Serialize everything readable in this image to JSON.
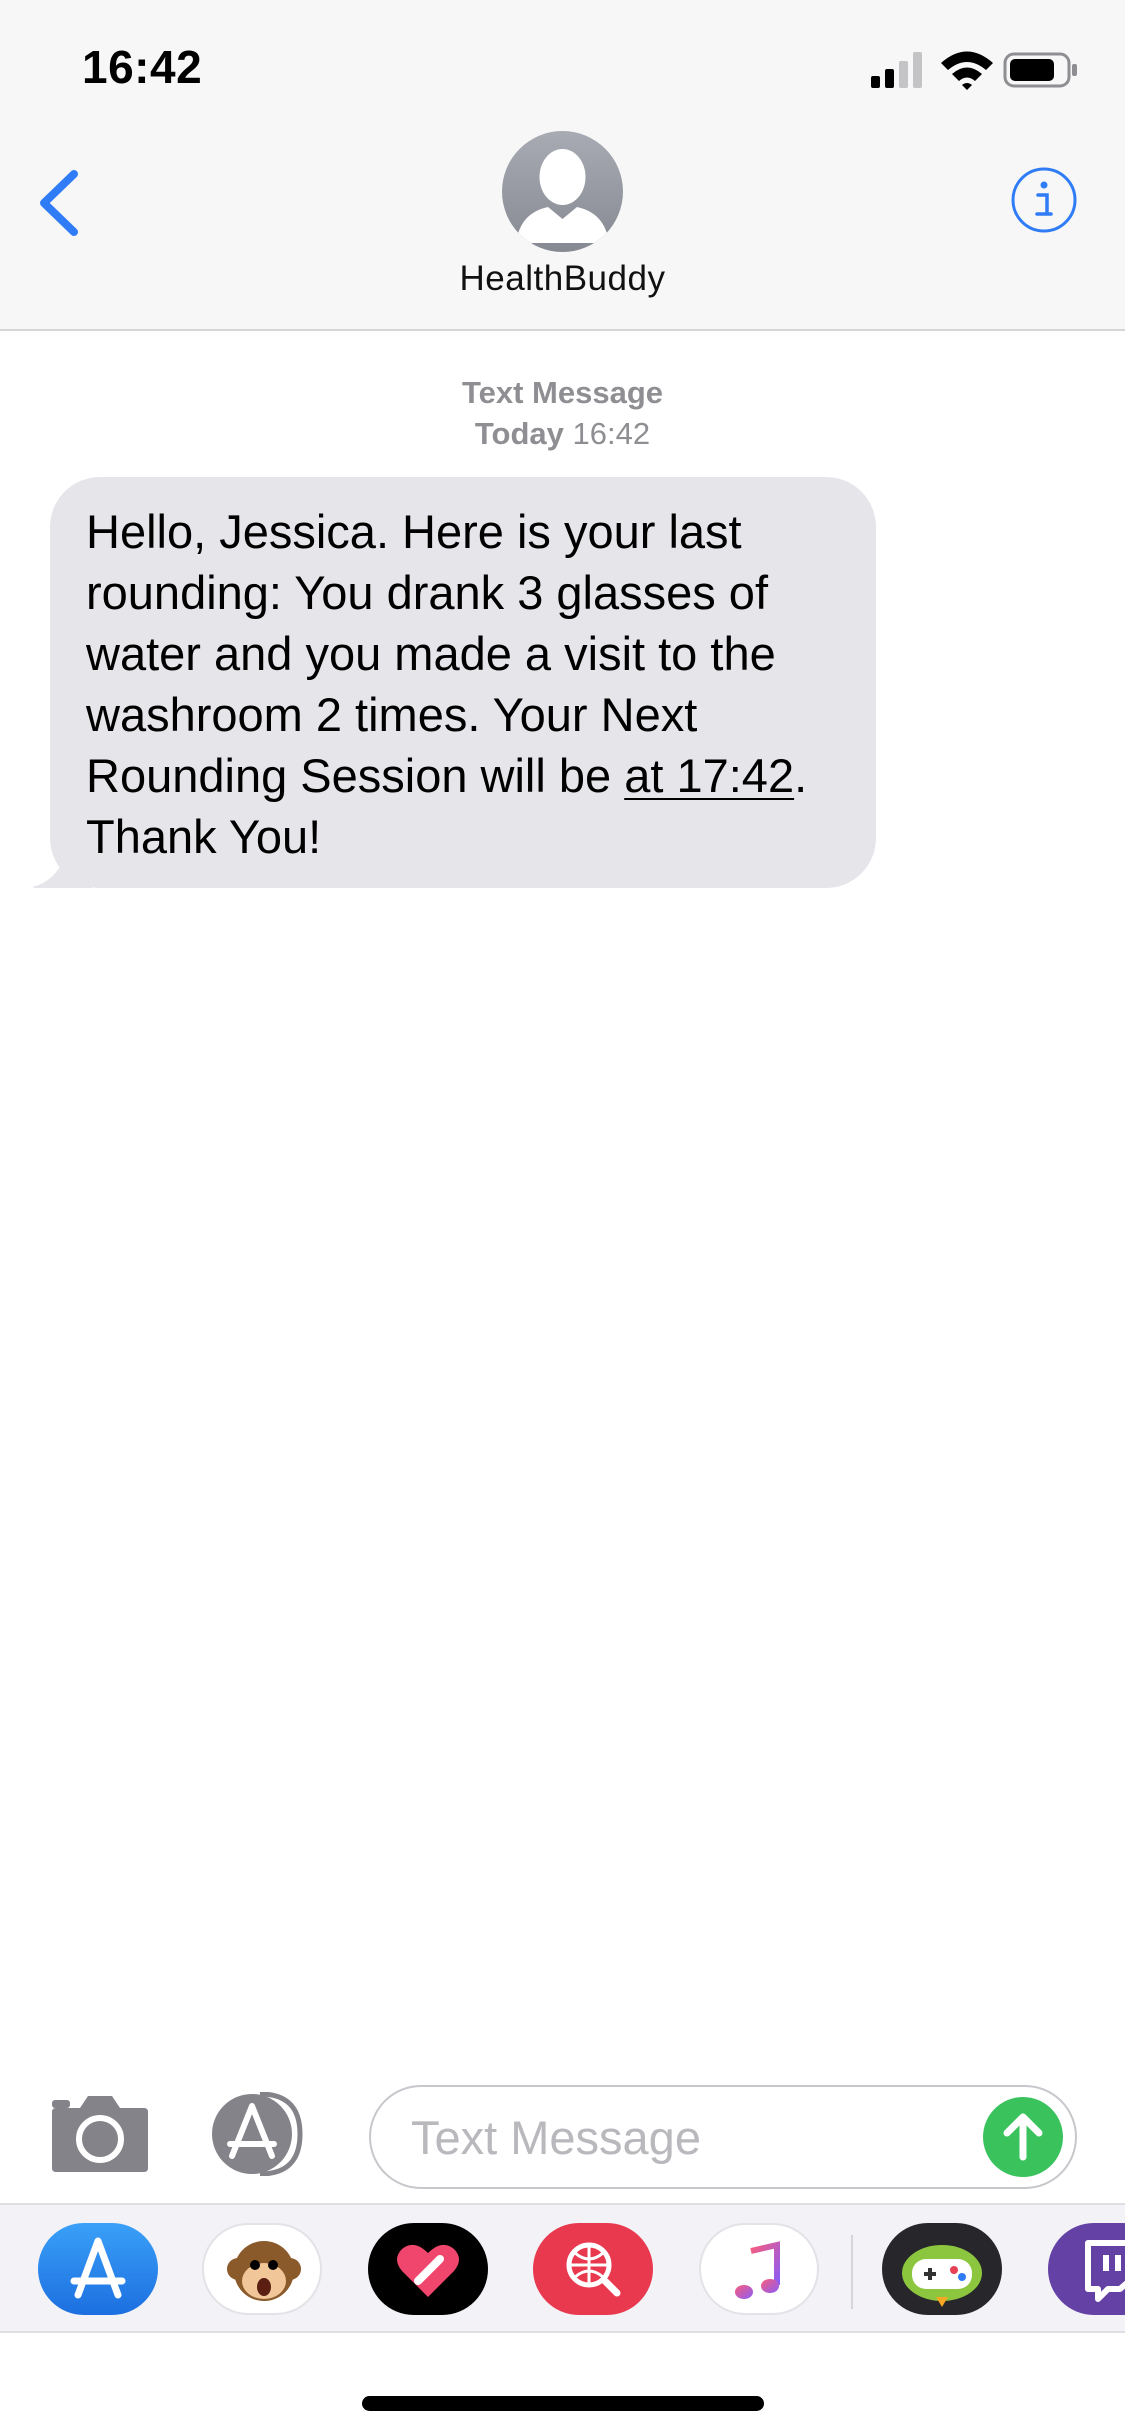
{
  "status_bar": {
    "time": "16:42",
    "icons": [
      "cellular-signal-icon",
      "wifi-icon",
      "battery-icon"
    ]
  },
  "header": {
    "contact_name": "HealthBuddy",
    "back_icon": "chevron-left-icon",
    "info_icon": "info-icon",
    "accent_color": "#2f7cf6"
  },
  "thread": {
    "timestamp_label": "Text Message",
    "timestamp_day": "Today",
    "timestamp_time": "16:42",
    "message": {
      "text_before_link": "Hello, Jessica. Here is your last rounding: You drank 3 glasses of water and you made a visit to the washroom 2 times. Your Next Rounding Session will be ",
      "link_text": "at 17:42",
      "text_after_link": ". Thank You!",
      "bubble_color": "#e5e5ea"
    }
  },
  "compose": {
    "placeholder": "Text Message",
    "value": "",
    "send_color": "#3ac35d"
  },
  "app_drawer": {
    "apps": [
      "app-store-icon",
      "animoji-monkey-icon",
      "digital-touch-heart-icon",
      "image-search-icon",
      "music-icon",
      "game-pigeon-icon",
      "twitch-icon"
    ]
  }
}
